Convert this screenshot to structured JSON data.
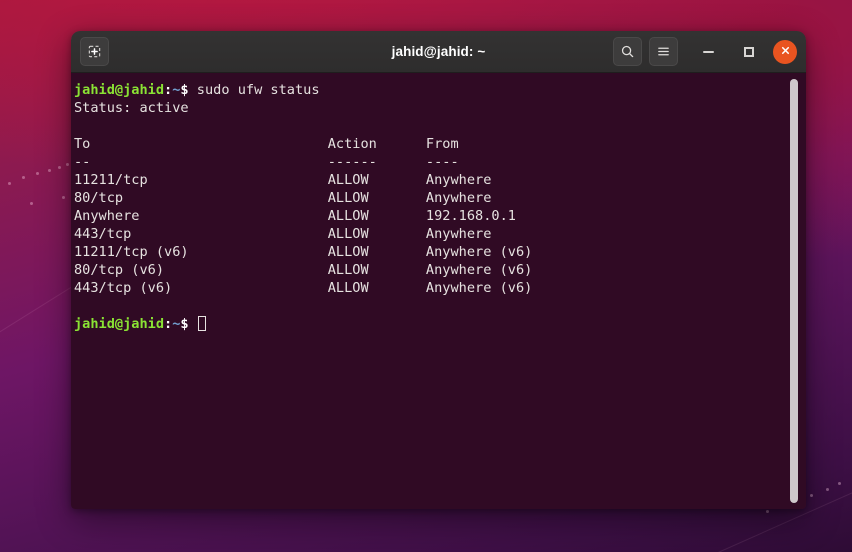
{
  "window": {
    "title": "jahid@jahid: ~",
    "new_tab_icon": "new-tab-icon",
    "search_icon": "search-icon",
    "menu_icon": "hamburger-menu-icon",
    "minimize_label": "",
    "maximize_label": "",
    "close_label": "",
    "accent_color": "#e95420",
    "titlebar_color": "#303030",
    "terminal_bg": "#300a24"
  },
  "terminal": {
    "prompt": {
      "user_host": "jahid@jahid",
      "colon": ":",
      "path": "~",
      "sigil": "$"
    },
    "command": "sudo ufw status",
    "status_line": "Status: active",
    "blank_line": "",
    "table": {
      "headers": [
        "To",
        "Action",
        "From"
      ],
      "separators": [
        "--",
        "------",
        "----"
      ],
      "rows": [
        [
          "11211/tcp",
          "ALLOW",
          "Anywhere"
        ],
        [
          "80/tcp",
          "ALLOW",
          "Anywhere"
        ],
        [
          "Anywhere",
          "ALLOW",
          "192.168.0.1"
        ],
        [
          "443/tcp",
          "ALLOW",
          "Anywhere"
        ],
        [
          "11211/tcp (v6)",
          "ALLOW",
          "Anywhere (v6)"
        ],
        [
          "80/tcp (v6)",
          "ALLOW",
          "Anywhere (v6)"
        ],
        [
          "443/tcp (v6)",
          "ALLOW",
          "Anywhere (v6)"
        ]
      ]
    },
    "columns": {
      "to_width": 31,
      "action_width": 12
    }
  }
}
